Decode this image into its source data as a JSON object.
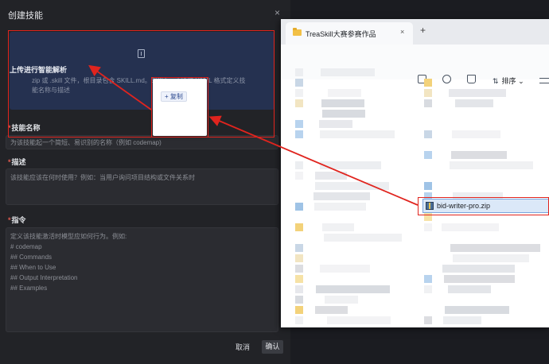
{
  "dialog": {
    "title": "创建技能",
    "close": "×",
    "upload": {
      "title": "上传进行智能解析",
      "description": "zip 或 .skill 文件，根目录包含 SKILL.md。SKILL.md 通过 YAML 格式定义技能名称与描述"
    },
    "copy_popup": {
      "label": "+ 复制"
    },
    "name_field": {
      "required_mark": "*",
      "label": "技能名称",
      "placeholder": "为该技能起一个简短、易识别的名称（例如 codemap)"
    },
    "desc_field": {
      "required_mark": "*",
      "label": "描述",
      "placeholder": "该技能应该在何时使用？例如：当用户询问项目结构或文件关系时"
    },
    "instructions_field": {
      "required_mark": "*",
      "label": "指令",
      "lines": [
        "定义该技能激活时模型应如何行为。例如:",
        "# codemap",
        "## Commands",
        "## When to Use",
        "## Output Interpretation",
        "## Examples"
      ]
    },
    "buttons": {
      "cancel": "取消",
      "confirm": "确认"
    }
  },
  "explorer": {
    "tab_title": "TreaSkill大赛参赛作品",
    "tab_close": "×",
    "tab_add": "+",
    "toolbar": {
      "sort_label": "排序",
      "sort_arrows": "⇅"
    },
    "selected_file": "bid-writer-pro.zip"
  },
  "colors": {
    "annotation_red": "#e0241e",
    "dialog_bg": "#222327",
    "upload_bg": "#253150",
    "selection_bg": "#dbe8f8"
  }
}
